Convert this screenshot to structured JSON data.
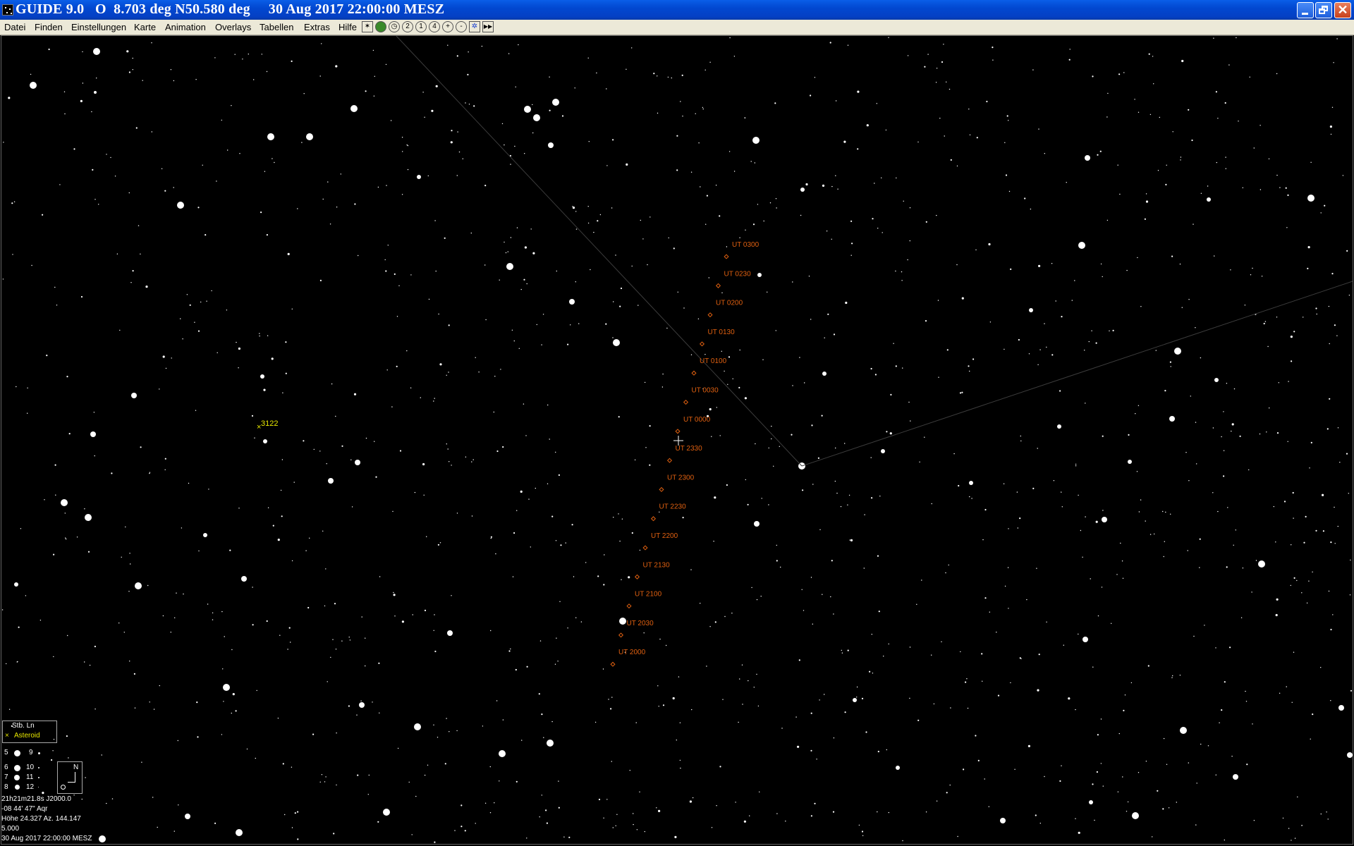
{
  "window": {
    "title": "GUIDE 9.0   O  8.703 deg N50.580 deg     30 Aug 2017 22:00:00 MESZ",
    "close_symbol": "✕"
  },
  "menu": [
    {
      "label": "Datei"
    },
    {
      "label": "Finden"
    },
    {
      "label": "Einstellungen"
    },
    {
      "label": "Karte"
    },
    {
      "label": "Animation"
    },
    {
      "label": "Overlays"
    },
    {
      "label": "Tabellen"
    },
    {
      "label": "Extras"
    },
    {
      "label": "Hilfe"
    }
  ],
  "toolbar": [
    {
      "icon": "star-chart-icon"
    },
    {
      "icon": "planet-icon"
    },
    {
      "icon": "clock-icon"
    },
    {
      "icon": "zoom-2-icon",
      "glyph": "2"
    },
    {
      "icon": "zoom-1-icon",
      "glyph": "1"
    },
    {
      "icon": "zoom-4-icon",
      "glyph": "4"
    },
    {
      "icon": "zoom-in-icon",
      "glyph": "+"
    },
    {
      "icon": "zoom-out-icon",
      "glyph": "-"
    },
    {
      "icon": "find-star-icon"
    },
    {
      "icon": "fast-forward-icon",
      "glyph": "▶▶"
    }
  ],
  "sky": {
    "asteroid_label": "3122",
    "asteroid_color": "#e8e800",
    "track_color": "#e06010",
    "track_labels": [
      "UT 0300",
      "UT 0230",
      "UT 0200",
      "UT 0130",
      "UT 0100",
      "UT 0030",
      "UT 0000",
      "UT 2330",
      "UT 2300",
      "UT 2230",
      "UT 2200",
      "UT 2130",
      "UT 2100",
      "UT 2030",
      "UT 2000"
    ]
  },
  "legend": {
    "line1": "Stb. Ln",
    "line2_marker": "×",
    "line2": "Asteroid",
    "north": "N",
    "mags": [
      {
        "a": "5",
        "b": "9"
      },
      {
        "a": "6",
        "b": "10"
      },
      {
        "a": "7",
        "b": "11"
      },
      {
        "a": "8",
        "b": "12"
      }
    ]
  },
  "status": {
    "ra": "21h21m21.8s  J2000.0",
    "dec": "-08 44' 47\"     Aqr",
    "alt_az": "Höhe 24.327  Az. 144.147",
    "field": "5.000",
    "datetime": "30 Aug 2017 22:00:00 MESZ"
  }
}
